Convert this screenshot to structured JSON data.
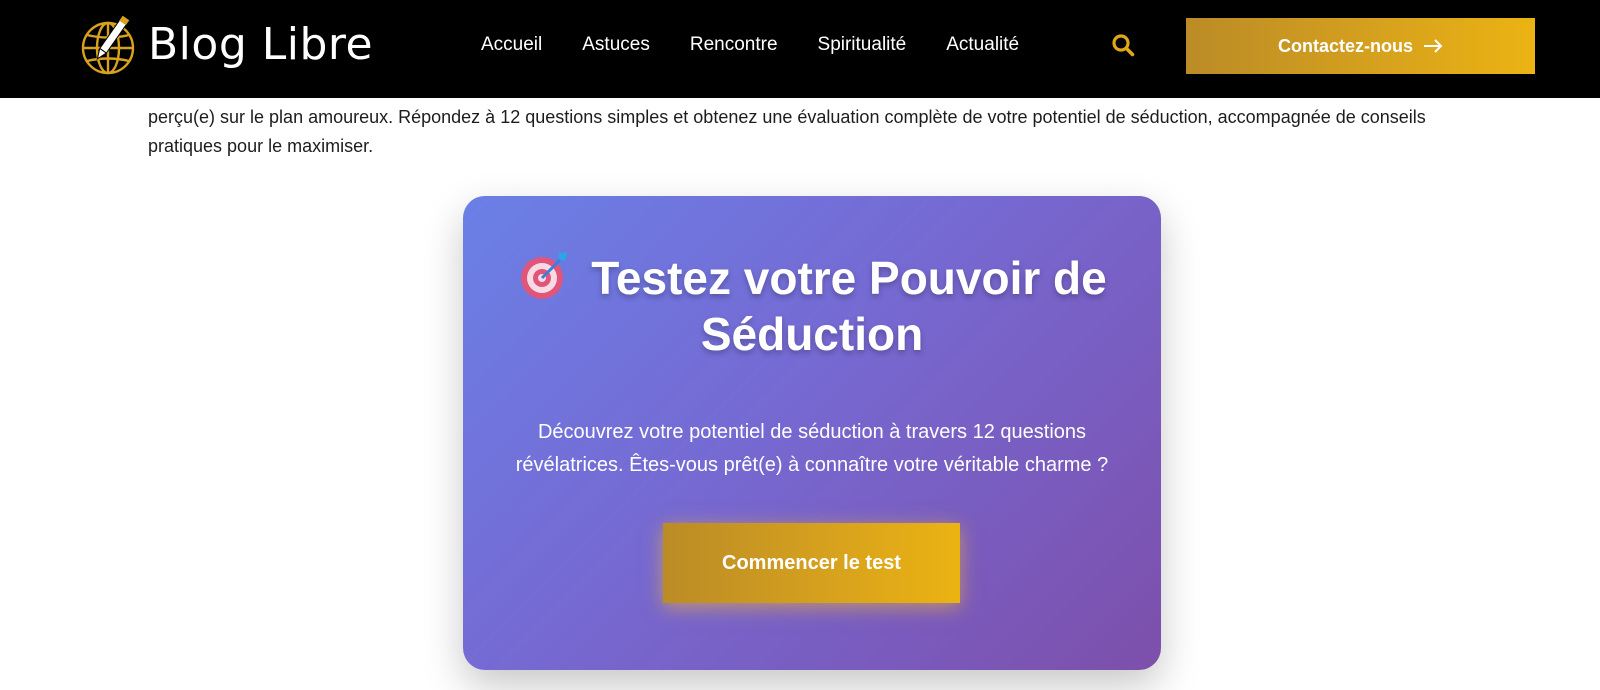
{
  "header": {
    "logo_text": "Blog Libre",
    "nav": [
      {
        "label": "Accueil"
      },
      {
        "label": "Astuces"
      },
      {
        "label": "Rencontre"
      },
      {
        "label": "Spiritualité"
      },
      {
        "label": "Actualité"
      }
    ],
    "search_icon": "search-icon",
    "contact_label": "Contactez-nous",
    "contact_icon": "arrow-right-icon"
  },
  "intro": {
    "text": "perçu(e) sur le plan amoureux. Répondez à 12 questions simples et obtenez une évaluation complète de votre potentiel de séduction, accompagnée de conseils pratiques pour le maximiser."
  },
  "quiz": {
    "icon": "target-icon",
    "title": "Testez votre Pouvoir de Séduction",
    "description": "Découvrez votre potentiel de séduction à travers 12 questions révélatrices. Êtes-vous prêt(e) à connaître votre véritable charme ?",
    "start_label": "Commencer le test"
  },
  "colors": {
    "header_bg": "#000000",
    "accent_gold": "#e0a817",
    "card_gradient_start": "#6a80e6",
    "card_gradient_end": "#7d4fab"
  }
}
